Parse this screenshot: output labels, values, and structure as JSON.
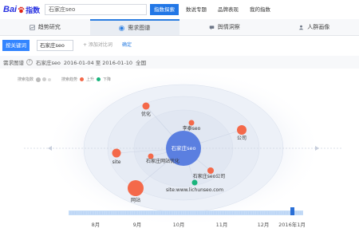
{
  "brand": {
    "logo_text_left": "Bai",
    "logo_text_right": "指数"
  },
  "search": {
    "value": "石家庄seo"
  },
  "nav": {
    "items": [
      "指数探索",
      "数说专题",
      "品牌表现",
      "我的指数"
    ],
    "active_index": 0
  },
  "tabs": [
    {
      "label": "趋势研究",
      "icon": "trend-icon"
    },
    {
      "label": "需求图谱",
      "icon": "graph-icon",
      "active": true
    },
    {
      "label": "舆情洞察",
      "icon": "chat-icon"
    },
    {
      "label": "人群画像",
      "icon": "people-icon"
    }
  ],
  "toolbar": {
    "keyword_button": "按关键词",
    "keyword_chip": "石家庄seo",
    "add_compare": "+ 添加对比词",
    "confirm": "确定"
  },
  "info": {
    "title": "需求图谱",
    "keyword": "石家庄seo",
    "date_range": "2016-01-04 至 2016-01-10",
    "region": "全国"
  },
  "legend": {
    "label1": "搜索指数",
    "label2": "搜索趋势",
    "rise": "上升",
    "fall": "下降"
  },
  "colors": {
    "accent": "#3385ff",
    "rising": "#f4694a",
    "falling": "#19b47c",
    "center": "#5b7fe0"
  },
  "graph": {
    "center": "石家庄seo",
    "nodes": [
      {
        "label": "优化",
        "trend": "rise"
      },
      {
        "label": "李泰seo",
        "trend": "rise"
      },
      {
        "label": "公司",
        "trend": "rise"
      },
      {
        "label": "site",
        "trend": "rise"
      },
      {
        "label": "石家庄网站优化",
        "trend": "rise"
      },
      {
        "label": "石家庄seo公司",
        "trend": "rise"
      },
      {
        "label": "site:www.lichunseo.com",
        "trend": "fall"
      },
      {
        "label": "网站",
        "trend": "rise"
      }
    ]
  },
  "timeline": {
    "months": [
      "8月",
      "9月",
      "10月",
      "11月",
      "12月",
      "2016年1月"
    ]
  }
}
